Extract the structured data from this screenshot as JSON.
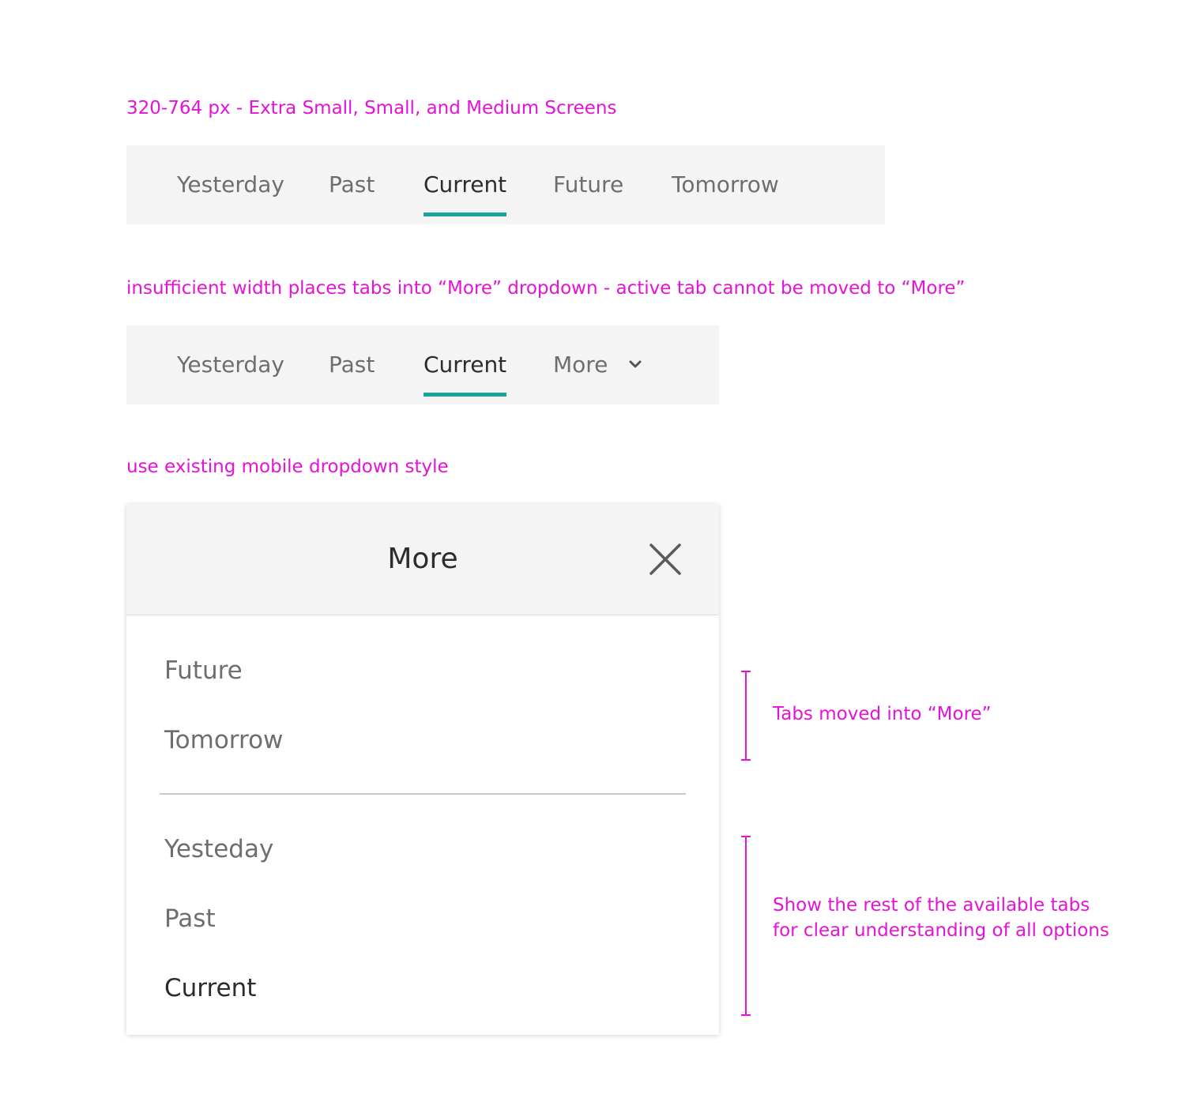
{
  "annotations": {
    "screen_range": "320-764 px - Extra Small, Small, and Medium Screens",
    "insufficient_width": "insufficient width places tabs into “More” dropdown - active tab cannot be moved to “More”",
    "dropdown_style": "use existing mobile dropdown style",
    "moved_tabs": "Tabs moved into “More”",
    "rest_line1": "Show the rest of the available tabs",
    "rest_line2": "for clear understanding of all options"
  },
  "tabbar_full": {
    "tabs": [
      "Yesterday",
      "Past",
      "Current",
      "Future",
      "Tomorrow"
    ],
    "active": "Current"
  },
  "tabbar_compact": {
    "tabs": [
      "Yesterday",
      "Past",
      "Current"
    ],
    "more_label": "More",
    "active": "Current"
  },
  "more_panel": {
    "title": "More",
    "moved_items": [
      "Future",
      "Tomorrow"
    ],
    "rest_items": [
      "Yesteday",
      "Past",
      "Current"
    ]
  },
  "colors": {
    "annotation": "#e413d6",
    "active_underline": "#1aa39a",
    "tabbar_bg": "#f4f4f4"
  },
  "icons": {
    "more_toggle": "chevron-down-icon",
    "close": "close-icon"
  }
}
